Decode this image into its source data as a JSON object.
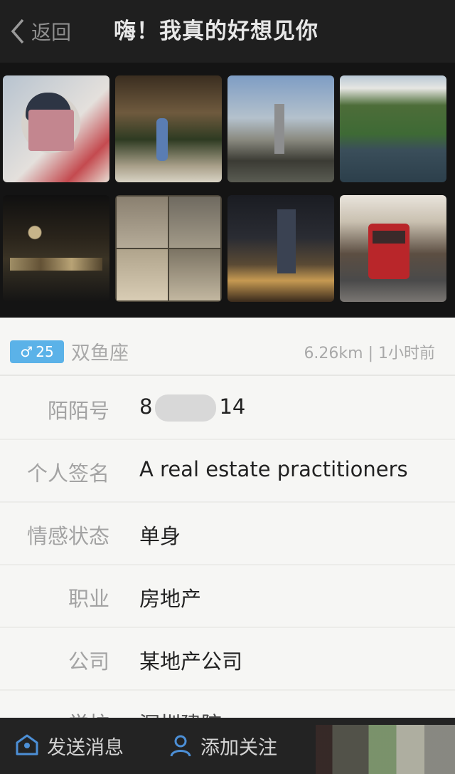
{
  "header": {
    "back_label": "返回",
    "title": "嗨！我真的好想见你"
  },
  "gallery": {
    "photo_count": 8
  },
  "profile": {
    "gender_symbol": "♂",
    "age": "25",
    "zodiac": "双鱼座",
    "distance_time": "6.26km | 1小时前",
    "accent_color": "#5bb2e8"
  },
  "fields": [
    {
      "label": "陌陌号",
      "value_prefix": "8",
      "value_suffix": "14"
    },
    {
      "label": "个人签名",
      "value": "A real estate practitioners"
    },
    {
      "label": "情感状态",
      "value": "单身"
    },
    {
      "label": "职业",
      "value": "房地产"
    },
    {
      "label": "公司",
      "value": "某地产公司"
    },
    {
      "label": "学校",
      "value": "深圳建院"
    }
  ],
  "bottom_bar": {
    "message_label": "发送消息",
    "follow_label": "添加关注"
  }
}
